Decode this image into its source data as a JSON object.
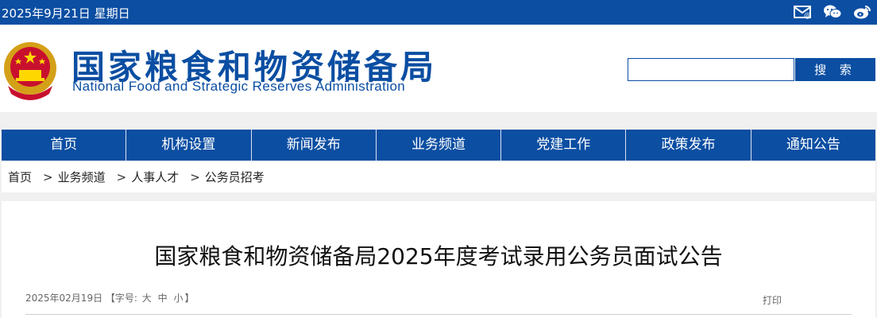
{
  "topbar": {
    "date": "2025年9月21日 星期日"
  },
  "icons": {
    "mail": "mail-icon",
    "wechat": "wechat-icon",
    "weibo": "weibo-icon",
    "emblem": "national-emblem"
  },
  "header": {
    "title_cn": "国家粮食和物资储备局",
    "title_en": "National Food and Strategic Reserves Administration"
  },
  "search": {
    "placeholder": "",
    "button_label": "搜 索"
  },
  "nav": {
    "items": [
      "首页",
      "机构设置",
      "新闻发布",
      "业务频道",
      "党建工作",
      "政策发布",
      "通知公告"
    ]
  },
  "breadcrumb": {
    "items": [
      "首页",
      "业务频道",
      "人事人才",
      "公务员招考"
    ],
    "separator": ">"
  },
  "article": {
    "title": "国家粮食和物资储备局2025年度考试录用公务员面试公告",
    "date": "2025年02月19日",
    "font_open": "【字号:",
    "font_large": "大",
    "font_medium": "中",
    "font_small": "小",
    "font_close": "】",
    "print_label": "打印"
  },
  "colors": {
    "primary": "#0b4ea2",
    "background_gray": "#f0f0f0"
  }
}
